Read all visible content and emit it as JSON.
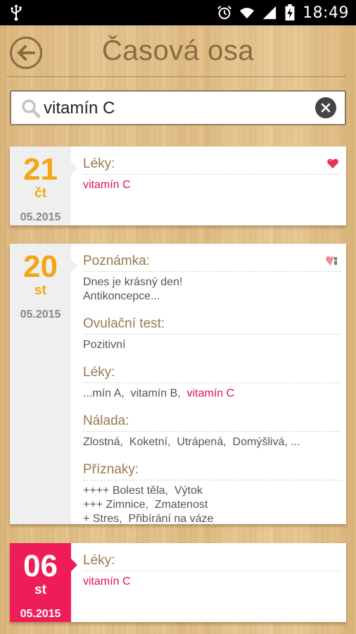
{
  "status_bar": {
    "time": "18:49"
  },
  "header": {
    "title": "Časová osa"
  },
  "search": {
    "value": "vitamín C"
  },
  "colors": {
    "accent_orange": "#f5a414",
    "accent_red": "#ef1d57",
    "title_brown": "#8a6a40"
  },
  "entries": [
    {
      "day": "21",
      "weekday": "čt",
      "month_year": "05.2015",
      "sections": [
        {
          "title": "Léky:",
          "lines": [
            {
              "parts": [
                {
                  "text": "vitamín C",
                  "highlight": true
                }
              ]
            }
          ]
        }
      ]
    },
    {
      "day": "20",
      "weekday": "st",
      "month_year": "05.2015",
      "sections": [
        {
          "title": "Poznámka:",
          "lines": [
            {
              "parts": [
                {
                  "text": "Dnes je krásný den!"
                }
              ]
            },
            {
              "parts": [
                {
                  "text": "Antikoncepce..."
                }
              ]
            }
          ]
        },
        {
          "title": "Ovulační test:",
          "lines": [
            {
              "parts": [
                {
                  "text": "Pozitivní"
                }
              ]
            }
          ]
        },
        {
          "title": "Léky:",
          "lines": [
            {
              "parts": [
                {
                  "text": "...mín A,  vitamín B,  "
                },
                {
                  "text": "vitamín C",
                  "highlight": true
                }
              ]
            }
          ]
        },
        {
          "title": "Nálada:",
          "lines": [
            {
              "parts": [
                {
                  "text": "Zlostná,  Koketní,  Utrápená,  Domýšlivá, ..."
                }
              ]
            }
          ]
        },
        {
          "title": "Příznaky:",
          "lines": [
            {
              "parts": [
                {
                  "text": "++++ Bolest těla,  Výtok"
                }
              ]
            },
            {
              "parts": [
                {
                  "text": "+++ Zimnice,  Zmatenost"
                }
              ]
            },
            {
              "parts": [
                {
                  "text": "+ Stres,  Přibírání na váze"
                }
              ]
            }
          ]
        }
      ]
    },
    {
      "day": "06",
      "weekday": "st",
      "month_year": "05.2015",
      "sections": [
        {
          "title": "Léky:",
          "lines": [
            {
              "parts": [
                {
                  "text": "vitamín C",
                  "highlight": true
                }
              ]
            }
          ]
        }
      ]
    }
  ]
}
